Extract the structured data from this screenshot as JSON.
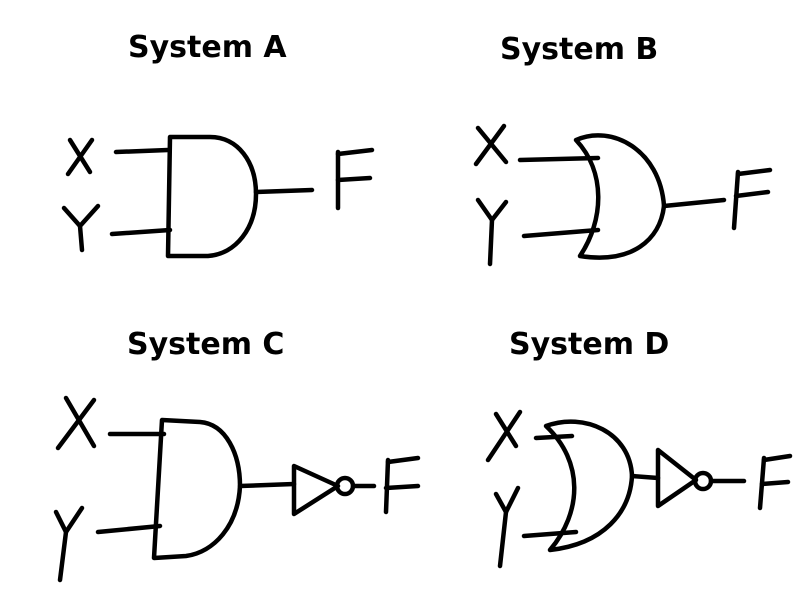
{
  "systems": [
    {
      "title": "System A",
      "inputs": [
        "X",
        "Y"
      ],
      "output": "F",
      "gate": "AND",
      "inverted_output": false
    },
    {
      "title": "System B",
      "inputs": [
        "X",
        "Y"
      ],
      "output": "F",
      "gate": "OR",
      "inverted_output": false
    },
    {
      "title": "System C",
      "inputs": [
        "X",
        "Y"
      ],
      "output": "F",
      "gate": "AND",
      "inverted_output": true
    },
    {
      "title": "System D",
      "inputs": [
        "X",
        "Y"
      ],
      "output": "F",
      "gate": "OR",
      "inverted_output": true
    }
  ],
  "colors": {
    "ink": "#000000",
    "background": "#ffffff"
  }
}
